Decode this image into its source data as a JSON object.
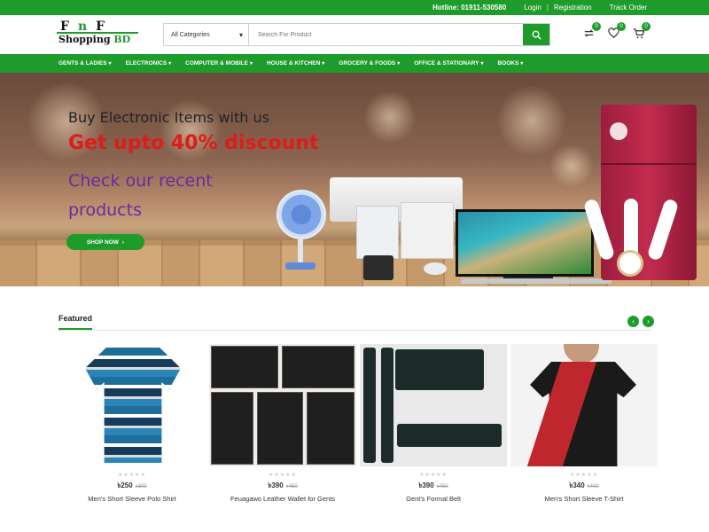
{
  "topbar": {
    "hotline": "Hotline: 01911-530580",
    "login": "Login",
    "separator": "|",
    "registration": "Registration",
    "track_order": "Track Order"
  },
  "logo": {
    "line1_f1": "F",
    "line1_n": "n",
    "line1_f2": "F",
    "line2_main": "Shopping",
    "line2_bd": "BD"
  },
  "search": {
    "category": "All Categories",
    "placeholder": "Search For Product"
  },
  "header_icons": [
    {
      "icon": "compare-icon",
      "count": "0"
    },
    {
      "icon": "heart-icon",
      "count": "0"
    },
    {
      "icon": "cart-icon",
      "count": "0"
    }
  ],
  "nav": [
    "GENTS & LADIES",
    "ELECTRONICS",
    "COMPUTER & MOBILE",
    "HOUSE & KITCHEN",
    "GROCERY & FOODS",
    "OFFICE & STATIONARY",
    "BOOKS"
  ],
  "hero": {
    "line1": "Buy Electronic Items with us",
    "line2": "Get upto 40% discount",
    "line3": "Check our recent products",
    "button": "SHOP NOW"
  },
  "featured": {
    "title": "Featured",
    "products": [
      {
        "name": "Men's Short Sleeve Polo Shirt",
        "price": "৳250",
        "old_price": "৳300"
      },
      {
        "name": "Feuagawo Leather Wallet for Gents",
        "price": "৳390",
        "old_price": "৳450"
      },
      {
        "name": "Gent's Formal Belt",
        "price": "৳390",
        "old_price": "৳450"
      },
      {
        "name": "Men's Short Sleeve T-Shirt",
        "price": "৳340",
        "old_price": "৳400"
      }
    ]
  },
  "colors": {
    "brand_green": "#1e9c2b",
    "headline_red": "#e01b1b",
    "headline_purple": "#6a2aa0"
  }
}
